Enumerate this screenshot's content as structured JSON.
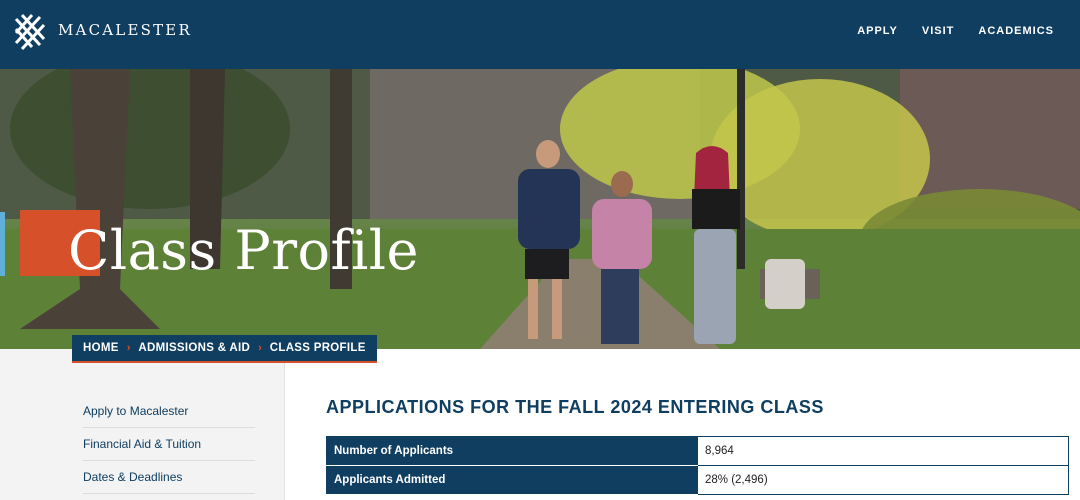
{
  "header": {
    "brand": "MACALESTER",
    "logo_icon": "macalester-plaid-logo-icon",
    "nav": [
      {
        "label": "APPLY"
      },
      {
        "label": "VISIT"
      },
      {
        "label": "ACADEMICS"
      }
    ]
  },
  "hero": {
    "title": "Class Profile",
    "accent_orange": "#d6502a",
    "accent_blue": "#5fb0d8"
  },
  "breadcrumb": {
    "items": [
      "HOME",
      "ADMISSIONS & AID",
      "CLASS PROFILE"
    ],
    "separator": "›"
  },
  "sidebar": {
    "items": [
      {
        "label": "Apply to Macalester"
      },
      {
        "label": "Financial Aid & Tuition"
      },
      {
        "label": "Dates & Deadlines"
      }
    ]
  },
  "main": {
    "section_title": "APPLICATIONS FOR THE FALL 2024 ENTERING CLASS",
    "rows": [
      {
        "label": "Number of Applicants",
        "value": "8,964"
      },
      {
        "label": "Applicants Admitted",
        "value": "28% (2,496)"
      }
    ]
  },
  "colors": {
    "brand_navy": "#0f3e61",
    "accent_orange": "#d6502a"
  }
}
